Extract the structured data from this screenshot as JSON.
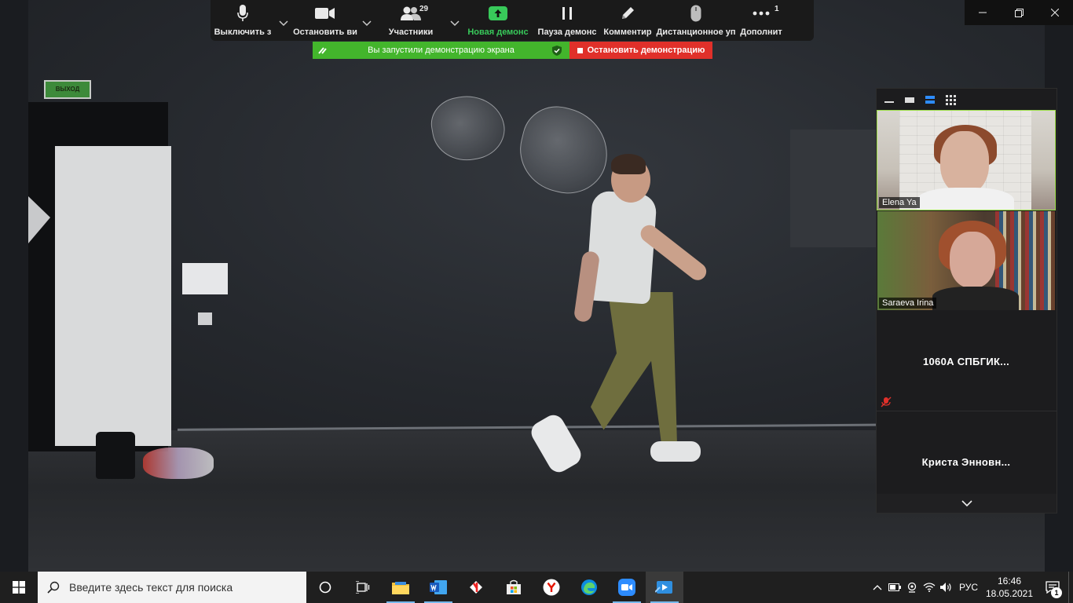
{
  "toolbar": {
    "items": [
      {
        "label": "Выключить з",
        "icon": "microphone-icon"
      },
      {
        "label": "Остановить ви",
        "icon": "video-camera-icon"
      },
      {
        "label": "Участники",
        "icon": "participants-icon",
        "count": "29"
      },
      {
        "label": "Новая демонс",
        "icon": "new-share-icon"
      },
      {
        "label": "Пауза демонс",
        "icon": "pause-icon"
      },
      {
        "label": "Комментир",
        "icon": "pencil-icon"
      },
      {
        "label": "Дистанционное уп",
        "icon": "mouse-icon"
      },
      {
        "label": "Дополнит",
        "icon": "more-icon",
        "count": "1"
      }
    ]
  },
  "share_banner": {
    "text": "Вы запустили демонстрацию экрана",
    "stop_label": "Остановить демонстрацию"
  },
  "scene": {
    "exit_sign": "ВЫХОД"
  },
  "participants": {
    "tiles": [
      {
        "name": "Elena Ya"
      },
      {
        "name": "Saraeva Irina"
      },
      {
        "name": "1060А СПБГИК..."
      },
      {
        "name": "Криста  Энновн..."
      }
    ]
  },
  "taskbar": {
    "search_placeholder": "Введите здесь текст для поиска",
    "language": "РУС",
    "time": "16:46",
    "date": "18.05.2021",
    "notification_count": "1"
  },
  "colors": {
    "share_green": "#43b52c",
    "stop_red": "#e0302a",
    "active_speaker": "#9ee04a",
    "new_share_green": "#38c95a"
  }
}
